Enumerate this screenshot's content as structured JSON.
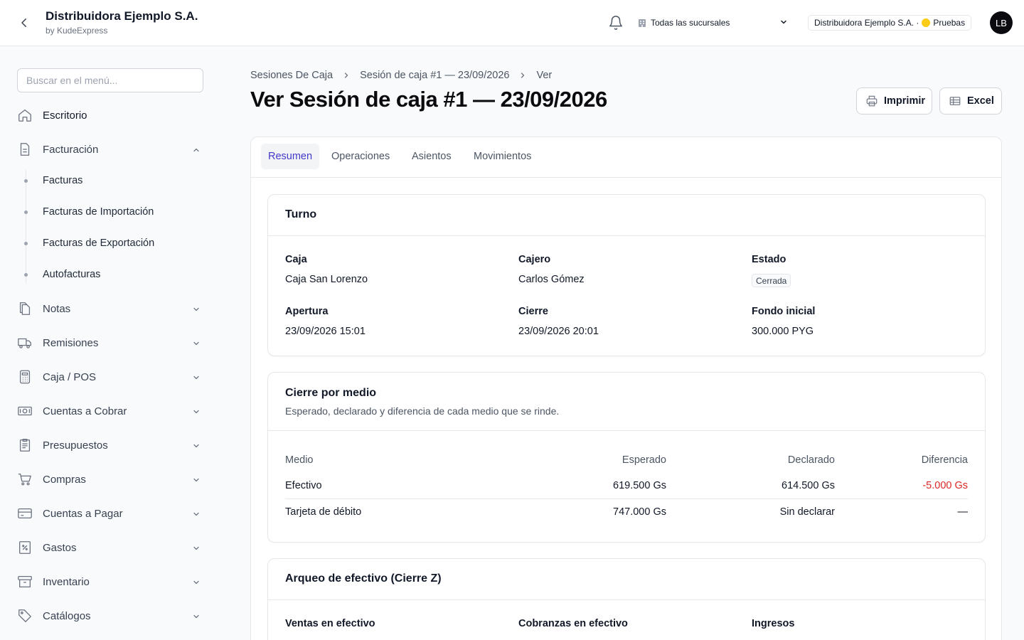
{
  "header": {
    "company_name": "Distribuidora Ejemplo S.A.",
    "subtitle": "by KudeExpress",
    "branch_selector": "Todas las sucursales",
    "company_badge": "Distribuidora Ejemplo S.A. ·",
    "environment": "Pruebas",
    "avatar_initials": "LB"
  },
  "sidebar": {
    "search_placeholder": "Buscar en el menú...",
    "items": [
      {
        "label": "Escritorio",
        "icon": "home-icon"
      },
      {
        "label": "Facturación",
        "icon": "document-icon"
      },
      {
        "label": "Notas",
        "icon": "notes-icon"
      },
      {
        "label": "Remisiones",
        "icon": "truck-icon"
      },
      {
        "label": "Caja / POS",
        "icon": "calculator-icon"
      },
      {
        "label": "Cuentas a Cobrar",
        "icon": "money-icon"
      },
      {
        "label": "Presupuestos",
        "icon": "clipboard-icon"
      },
      {
        "label": "Compras",
        "icon": "cart-icon"
      },
      {
        "label": "Cuentas a Pagar",
        "icon": "card-icon"
      },
      {
        "label": "Gastos",
        "icon": "receipt-icon"
      },
      {
        "label": "Inventario",
        "icon": "archive-icon"
      },
      {
        "label": "Catálogos",
        "icon": "tag-icon"
      }
    ],
    "facturacion_sub": [
      "Facturas",
      "Facturas de Importación",
      "Facturas de Exportación",
      "Autofacturas"
    ]
  },
  "breadcrumb": [
    "Sesiones De Caja",
    "Sesión de caja #1 — 23/09/2026",
    "Ver"
  ],
  "page_title": "Ver Sesión de caja #1 — 23/09/2026",
  "actions": {
    "print": "Imprimir",
    "excel": "Excel"
  },
  "tabs": [
    "Resumen",
    "Operaciones",
    "Asientos",
    "Movimientos"
  ],
  "turno": {
    "title": "Turno",
    "fields": {
      "caja": {
        "label": "Caja",
        "value": "Caja San Lorenzo"
      },
      "cajero": {
        "label": "Cajero",
        "value": "Carlos Gómez"
      },
      "estado": {
        "label": "Estado",
        "value": "Cerrada"
      },
      "apertura": {
        "label": "Apertura",
        "value": "23/09/2026 15:01"
      },
      "cierre": {
        "label": "Cierre",
        "value": "23/09/2026 20:01"
      },
      "fondo": {
        "label": "Fondo inicial",
        "value": "300.000 PYG"
      }
    }
  },
  "cierre": {
    "title": "Cierre por medio",
    "description": "Esperado, declarado y diferencia de cada medio que se rinde.",
    "columns": [
      "Medio",
      "Esperado",
      "Declarado",
      "Diferencia"
    ],
    "rows": [
      {
        "medio": "Efectivo",
        "esperado": "619.500 Gs",
        "declarado": "614.500 Gs",
        "diferencia": "-5.000 Gs"
      },
      {
        "medio": "Tarjeta de débito",
        "esperado": "747.000 Gs",
        "declarado": "Sin declarar",
        "diferencia": "—"
      }
    ]
  },
  "arqueo": {
    "title": "Arqueo de efectivo (Cierre Z)",
    "fields": [
      "Ventas en efectivo",
      "Cobranzas en efectivo",
      "Ingresos"
    ]
  },
  "colors": {
    "accent": "#4338ca",
    "negative": "#dc2626",
    "env_dot": "#facc15"
  }
}
